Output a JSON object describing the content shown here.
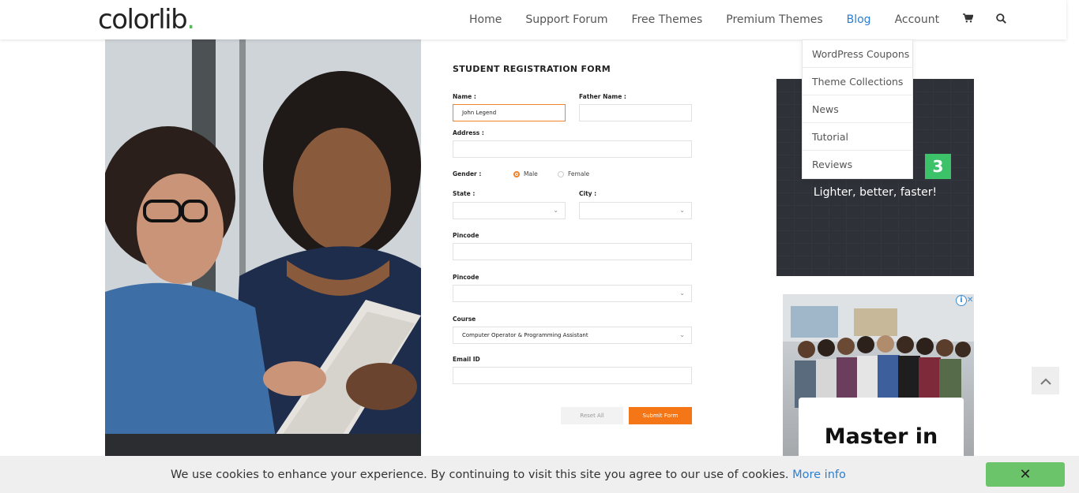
{
  "header": {
    "logo_text": "colorlib",
    "logo_dot": ".",
    "nav": [
      {
        "label": "Home"
      },
      {
        "label": "Support Forum"
      },
      {
        "label": "Free Themes"
      },
      {
        "label": "Premium Themes"
      },
      {
        "label": "Blog",
        "active": true
      },
      {
        "label": "Account"
      }
    ],
    "cart_icon": "cart-icon",
    "search_icon": "search-icon"
  },
  "blog_dropdown": {
    "items": [
      {
        "label": "WordPress Coupons"
      },
      {
        "label": "Theme Collections"
      },
      {
        "label": "News"
      },
      {
        "label": "Tutorial"
      },
      {
        "label": "Reviews"
      }
    ]
  },
  "form": {
    "title": "STUDENT REGISTRATION FORM",
    "name_label": "Name :",
    "name_value": "John Legend",
    "father_name_label": "Father Name :",
    "address_label": "Address :",
    "gender_label": "Gender :",
    "gender_options": [
      "Male",
      "Female"
    ],
    "gender_selected": "Male",
    "state_label": "State :",
    "city_label": "City :",
    "pincode_label": "Pincode",
    "pincode2_label": "Pincode",
    "course_label": "Course",
    "course_value": "Computer Operator & Programming Assistant",
    "email_label": "Email ID",
    "reset_label": "Reset All",
    "submit_label": "Submit Form",
    "accent": "#f47617"
  },
  "sidebar": {
    "ad1": {
      "badge": "3",
      "tagline": "Lighter, better, faster!"
    },
    "ad2": {
      "card_title": "Master in"
    }
  },
  "cookie_bar": {
    "text": "We use cookies to enhance your experience. By continuing to visit this site you agree to our use of cookies.",
    "link": "More info",
    "close": "✕"
  },
  "colors": {
    "brand_blue": "#2a7fd4",
    "brand_green": "#5cb85c",
    "accent_orange": "#f47617"
  }
}
